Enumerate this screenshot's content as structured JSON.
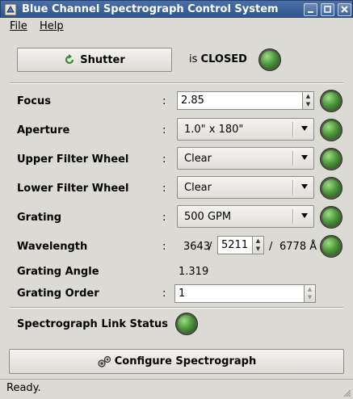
{
  "window": {
    "title": "Blue Channel Spectrograph Control System"
  },
  "menu": {
    "file": "File",
    "help": "Help"
  },
  "shutter": {
    "button_label": "Shutter",
    "status_prefix": "is ",
    "status_value": "CLOSED"
  },
  "fields": {
    "focus": {
      "label": "Focus",
      "value": "2.85"
    },
    "aperture": {
      "label": "Aperture",
      "value": "1.0\" x 180\""
    },
    "upper_filter": {
      "label": "Upper Filter Wheel",
      "value": "Clear"
    },
    "lower_filter": {
      "label": "Lower Filter Wheel",
      "value": "Clear"
    },
    "grating": {
      "label": "Grating",
      "value": "500 GPM"
    },
    "wavelength": {
      "label": "Wavelength",
      "min": "3643",
      "sep1": "/",
      "value": "5211",
      "sep2": "/",
      "max": "6778 Å"
    },
    "grating_angle": {
      "label": "Grating Angle",
      "value": "1.319"
    },
    "grating_order": {
      "label": "Grating Order",
      "value": "1"
    }
  },
  "colon": ":",
  "link_status": {
    "label": "Spectrograph Link Status"
  },
  "configure": {
    "button_label": "Configure Spectrograph"
  },
  "status": {
    "text": "Ready."
  },
  "colors": {
    "title_bar": "#2f5592",
    "led_green": "#4e9a3c",
    "background": "#dcdad5"
  }
}
